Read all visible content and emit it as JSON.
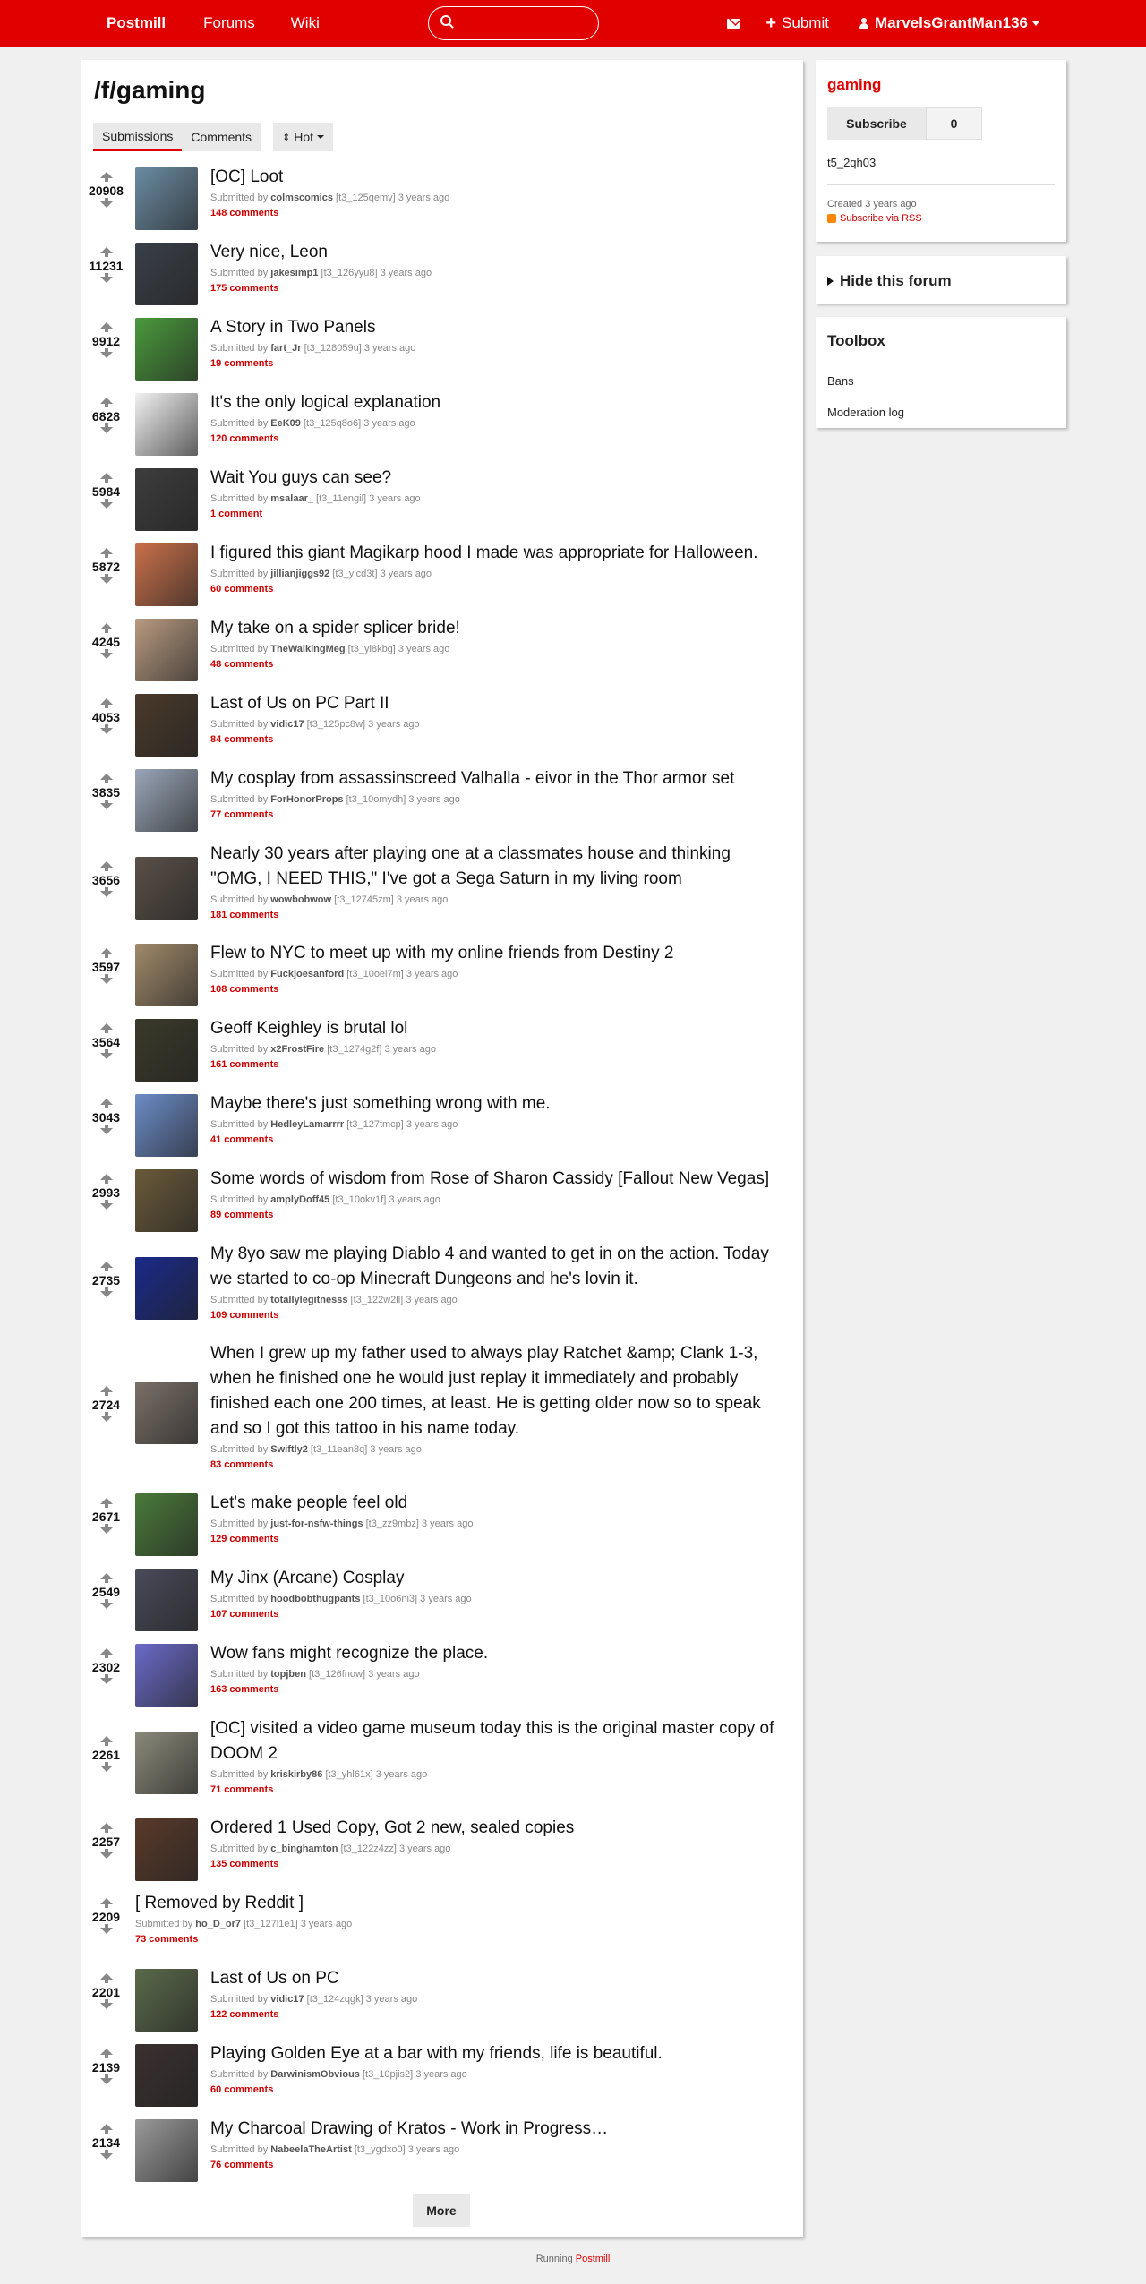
{
  "topbar": {
    "brand": "Postmill",
    "nav": [
      "Forums",
      "Wiki"
    ],
    "submit": "Submit",
    "username": "MarvelsGrantMan136",
    "icons": {
      "search": "search-icon",
      "mail": "envelope-icon",
      "submit": "plus-icon",
      "user": "user-icon"
    }
  },
  "forum": {
    "title": "/f/gaming",
    "tabs": [
      "Submissions",
      "Comments"
    ],
    "sort": "Hot"
  },
  "posts": [
    {
      "score": "20908",
      "title": "[OC] Loot",
      "author": "colmscomics",
      "id": "[t3_125qemv]",
      "time": "3 years ago",
      "comments": "148 comments",
      "thumb": "#6b8ca3"
    },
    {
      "score": "11231",
      "title": "Very nice, Leon",
      "author": "jakesimp1",
      "id": "[t3_126yyu8]",
      "time": "3 years ago",
      "comments": "175 comments",
      "thumb": "#3a4048"
    },
    {
      "score": "9912",
      "title": "A Story in Two Panels",
      "author": "fart_Jr",
      "id": "[t3_128059u]",
      "time": "3 years ago",
      "comments": "19 comments",
      "thumb": "#4a9a3c"
    },
    {
      "score": "6828",
      "title": "It's the only logical explanation",
      "author": "EeK09",
      "id": "[t3_125q8o6]",
      "time": "3 years ago",
      "comments": "120 comments",
      "thumb": "#f2f2f2"
    },
    {
      "score": "5984",
      "title": "Wait You guys can see?",
      "author": "msalaar_",
      "id": "[t3_11engil]",
      "time": "3 years ago",
      "comments": "1 comment",
      "thumb": "#3d3d3d"
    },
    {
      "score": "5872",
      "title": "I figured this giant Magikarp hood I made was appropriate for Halloween.",
      "author": "jillianjiggs92",
      "id": "[t3_yicd3t]",
      "time": "3 years ago",
      "comments": "60 comments",
      "thumb": "#c9704a"
    },
    {
      "score": "4245",
      "title": "My take on a spider splicer bride!",
      "author": "TheWalkingMeg",
      "id": "[t3_yi8kbg]",
      "time": "3 years ago",
      "comments": "48 comments",
      "thumb": "#b89a80"
    },
    {
      "score": "4053",
      "title": "Last of Us on PC Part II",
      "author": "vidic17",
      "id": "[t3_125pc8w]",
      "time": "3 years ago",
      "comments": "84 comments",
      "thumb": "#4a3a2a"
    },
    {
      "score": "3835",
      "title": "My cosplay from assassinscreed Valhalla - eivor in the Thor armor set",
      "author": "ForHonorProps",
      "id": "[t3_10omydh]",
      "time": "3 years ago",
      "comments": "77 comments",
      "thumb": "#9aa6b8"
    },
    {
      "score": "3656",
      "title": "Nearly 30 years after playing one at a classmates house and thinking \"OMG, I NEED THIS,\" I've got a Sega Saturn in my living room",
      "author": "wowbobwow",
      "id": "[t3_12745zm]",
      "time": "3 years ago",
      "comments": "181 comments",
      "thumb": "#5a5048"
    },
    {
      "score": "3597",
      "title": "Flew to NYC to meet up with my online friends from Destiny 2",
      "author": "Fuckjoesanford",
      "id": "[t3_10oei7m]",
      "time": "3 years ago",
      "comments": "108 comments",
      "thumb": "#a08a6a"
    },
    {
      "score": "3564",
      "title": "Geoff Keighley is brutal lol",
      "author": "x2FrostFire",
      "id": "[t3_1274g2f]",
      "time": "3 years ago",
      "comments": "161 comments",
      "thumb": "#3a3a2a"
    },
    {
      "score": "3043",
      "title": "Maybe there's just something wrong with me.",
      "author": "HedleyLamarrrr",
      "id": "[t3_127tmcp]",
      "time": "3 years ago",
      "comments": "41 comments",
      "thumb": "#6c8cc8"
    },
    {
      "score": "2993",
      "title": "Some words of wisdom from Rose of Sharon Cassidy [Fallout New Vegas]",
      "author": "amplyDoff45",
      "id": "[t3_10okv1f]",
      "time": "3 years ago",
      "comments": "89 comments",
      "thumb": "#6a5a3a"
    },
    {
      "score": "2735",
      "title": "My 8yo saw me playing Diablo 4 and wanted to get in on the action. Today we started to co-op Minecraft Dungeons and he's lovin it.",
      "author": "totallylegitnesss",
      "id": "[t3_122w2ll]",
      "time": "3 years ago",
      "comments": "109 comments",
      "thumb": "#1a2a8a"
    },
    {
      "score": "2724",
      "title": "When I grew up my father used to always play Ratchet &amp; Clank 1-3, when he finished one he would just replay it immediately and probably finished each one 200 times, at least. He is getting older now so to speak and so I got this tattoo in his name today.",
      "author": "Swiftly2",
      "id": "[t3_11ean8q]",
      "time": "3 years ago",
      "comments": "83 comments",
      "thumb": "#7a7068"
    },
    {
      "score": "2671",
      "title": "Let's make people feel old",
      "author": "just-for-nsfw-things",
      "id": "[t3_zz9mbz]",
      "time": "3 years ago",
      "comments": "129 comments",
      "thumb": "#4a7a3a"
    },
    {
      "score": "2549",
      "title": "My Jinx (Arcane) Cosplay",
      "author": "hoodbobthugpants",
      "id": "[t3_10o6ni3]",
      "time": "3 years ago",
      "comments": "107 comments",
      "thumb": "#4a4a5a"
    },
    {
      "score": "2302",
      "title": "Wow fans might recognize the place.",
      "author": "topjben",
      "id": "[t3_126fnow]",
      "time": "3 years ago",
      "comments": "163 comments",
      "thumb": "#6a6ac8"
    },
    {
      "score": "2261",
      "title": "[OC] visited a video game museum today this is the original master copy of DOOM 2",
      "author": "kriskirby86",
      "id": "[t3_yhl61x]",
      "time": "3 years ago",
      "comments": "71 comments",
      "thumb": "#8a8a7a"
    },
    {
      "score": "2257",
      "title": "Ordered 1 Used Copy, Got 2 new, sealed copies",
      "author": "c_binghamton",
      "id": "[t3_122z4zz]",
      "time": "3 years ago",
      "comments": "135 comments",
      "thumb": "#5a3a2a"
    },
    {
      "score": "2209",
      "title": "[ Removed by Reddit ]",
      "author": "ho_D_or7",
      "id": "[t3_127l1e1]",
      "time": "3 years ago",
      "comments": "73 comments",
      "thumb": ""
    },
    {
      "score": "2201",
      "title": "Last of Us on PC",
      "author": "vidic17",
      "id": "[t3_124zqgk]",
      "time": "3 years ago",
      "comments": "122 comments",
      "thumb": "#5a6a4a"
    },
    {
      "score": "2139",
      "title": "Playing Golden Eye at a bar with my friends, life is beautiful.",
      "author": "DarwinismObvious",
      "id": "[t3_10pjis2]",
      "time": "3 years ago",
      "comments": "60 comments",
      "thumb": "#3a3030"
    },
    {
      "score": "2134",
      "title": "My Charcoal Drawing of Kratos - Work in Progress…",
      "author": "NabeelaTheArtist",
      "id": "[t3_ygdxo0]",
      "time": "3 years ago",
      "comments": "76 comments",
      "thumb": "#9a9a9a"
    }
  ],
  "submitted_by": "Submitted by",
  "more": "More",
  "sidebar": {
    "forum_name": "gaming",
    "subscribe": "Subscribe",
    "subscriber_count": "0",
    "forum_id": "t5_2qh03",
    "created": "Created 3 years ago",
    "rss": "Subscribe via RSS",
    "hide_forum": "Hide this forum",
    "toolbox_title": "Toolbox",
    "toolbox_links": [
      "Bans",
      "Moderation log"
    ]
  },
  "footer": {
    "prefix": "Running",
    "brand": "Postmill"
  },
  "colors": {
    "accent": "#e00000",
    "comments": "#cc0000"
  }
}
